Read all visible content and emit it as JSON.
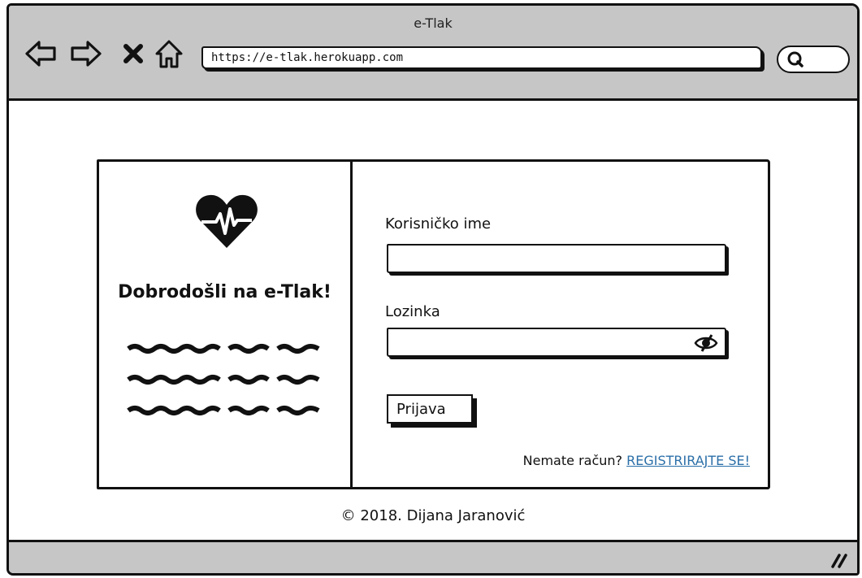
{
  "window": {
    "title": "e-Tlak"
  },
  "toolbar": {
    "back_icon": "arrow-left-icon",
    "forward_icon": "arrow-right-icon",
    "stop_icon": "close-icon",
    "home_icon": "home-icon",
    "search_icon": "search-icon"
  },
  "address_bar": {
    "url": "https://e-tlak.herokuapp.com"
  },
  "login_card": {
    "logo_icon": "heart-pulse-icon",
    "welcome": "Dobrodošli na e-Tlak!",
    "username_label": "Korisničko ime",
    "username_value": "",
    "password_label": "Lozinka",
    "password_value": "",
    "show_password_icon": "eye-hidden-icon",
    "login_button": "Prijava",
    "register_prompt": "Nemate račun?",
    "register_link": "REGISTRIRAJTE SE!"
  },
  "footer": {
    "copyright": "© 2018. Dijana Jaranović"
  },
  "colors": {
    "chrome": "#c6c6c6",
    "link": "#2b6fa8",
    "ink": "#111111"
  }
}
